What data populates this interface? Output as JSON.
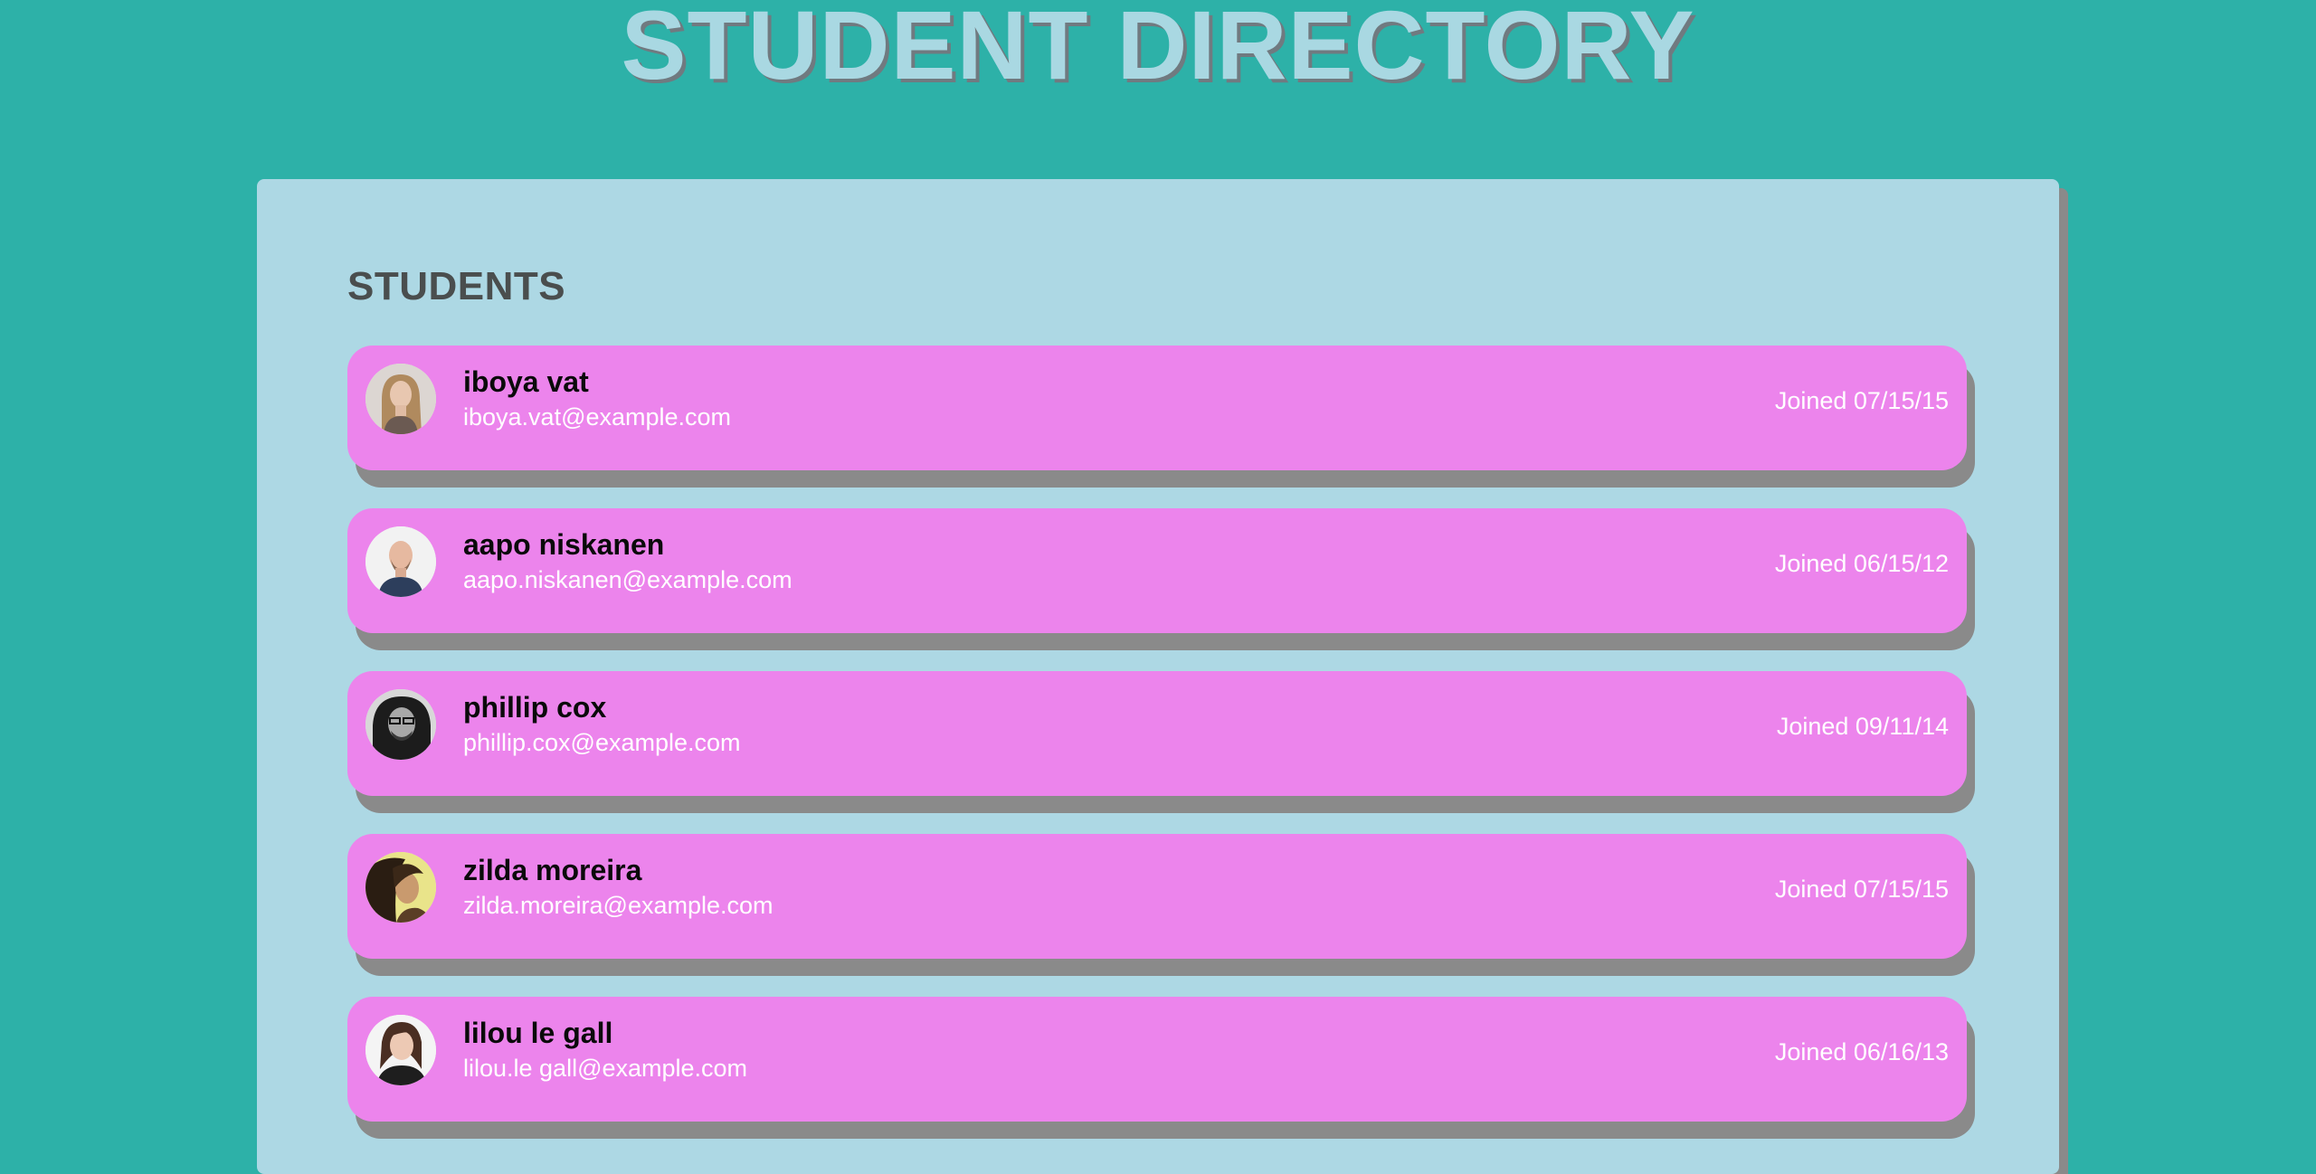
{
  "page": {
    "title": "STUDENT DIRECTORY"
  },
  "panel": {
    "heading": "STUDENTS"
  },
  "students": [
    {
      "name": "iboya vat",
      "email": "iboya.vat@example.com",
      "joined": "Joined 07/15/15"
    },
    {
      "name": "aapo niskanen",
      "email": "aapo.niskanen@example.com",
      "joined": "Joined 06/15/12"
    },
    {
      "name": "phillip cox",
      "email": "phillip.cox@example.com",
      "joined": "Joined 09/11/14"
    },
    {
      "name": "zilda moreira",
      "email": "zilda.moreira@example.com",
      "joined": "Joined 07/15/15"
    },
    {
      "name": "lilou le gall",
      "email": "lilou.le gall@example.com",
      "joined": "Joined 06/16/13"
    }
  ],
  "colors": {
    "background": "#2db1a8",
    "panel": "#add8e4",
    "card": "#ec84ec",
    "title": "#a9d8e2",
    "shadow": "#8a8a8a"
  }
}
